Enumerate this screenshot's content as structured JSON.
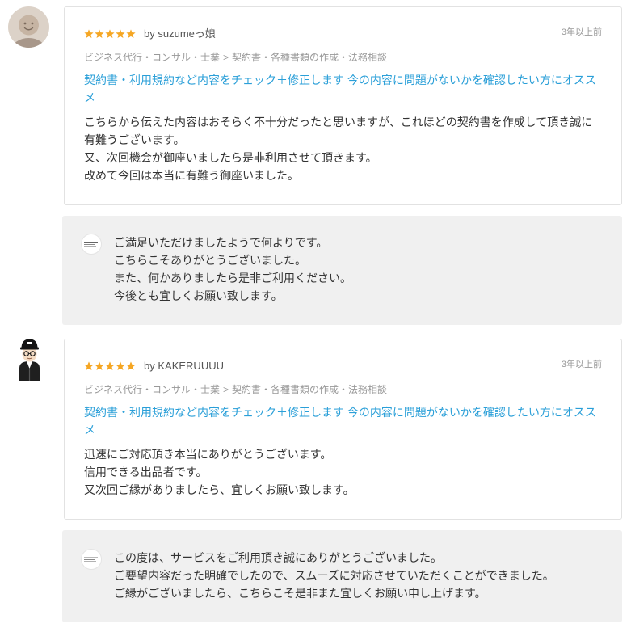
{
  "labels": {
    "by": "by"
  },
  "reviews": [
    {
      "avatar_icon": "default-user-avatar-icon",
      "rating": 5,
      "reviewer": "suzumeっ娘",
      "date": "3年以上前",
      "category": {
        "parent": "ビジネス代行・コンサル・士業",
        "separator": ">",
        "child": "契約書・各種書類の作成・法務相談"
      },
      "service_title": "契約書・利用規約など内容をチェック＋修正します 今の内容に問題がないかを確認したい方にオススメ",
      "body": [
        "こちらから伝えた内容はおそらく不十分だったと思いますが、これほどの契約書を作成して頂き誠に有難うございます。",
        "又、次回機会が御座いましたら是非利用させて頂きます。",
        "改めて今回は本当に有難う御座いました。"
      ],
      "reply": {
        "avatar_icon": "seller-logo-icon",
        "lines": [
          "ご満足いただけましたようで何よりです。",
          "こちらこそありがとうございました。",
          "また、何かありましたら是非ご利用ください。",
          "今後とも宜しくお願い致します。"
        ]
      }
    },
    {
      "avatar_icon": "cartoon-person-avatar-icon",
      "rating": 5,
      "reviewer": "KAKERUUUU",
      "date": "3年以上前",
      "category": {
        "parent": "ビジネス代行・コンサル・士業",
        "separator": ">",
        "child": "契約書・各種書類の作成・法務相談"
      },
      "service_title": "契約書・利用規約など内容をチェック＋修正します 今の内容に問題がないかを確認したい方にオススメ",
      "body": [
        "迅速にご対応頂き本当にありがとうございます。",
        "信用できる出品者です。",
        "又次回ご縁がありましたら、宜しくお願い致します。"
      ],
      "reply": {
        "avatar_icon": "seller-logo-icon",
        "lines": [
          "この度は、サービスをご利用頂き誠にありがとうございました。",
          "ご要望内容だった明確でしたので、スムーズに対応させていただくことができました。",
          "ご縁がございましたら、こちらこそ是非また宜しくお願い申し上げます。"
        ]
      }
    }
  ],
  "colors": {
    "star": "#f5a623",
    "link": "#2a9fd8",
    "text": "#333333",
    "muted": "#999999",
    "reply_background": "#f0f0f0",
    "card_border": "#e2e2e2"
  }
}
